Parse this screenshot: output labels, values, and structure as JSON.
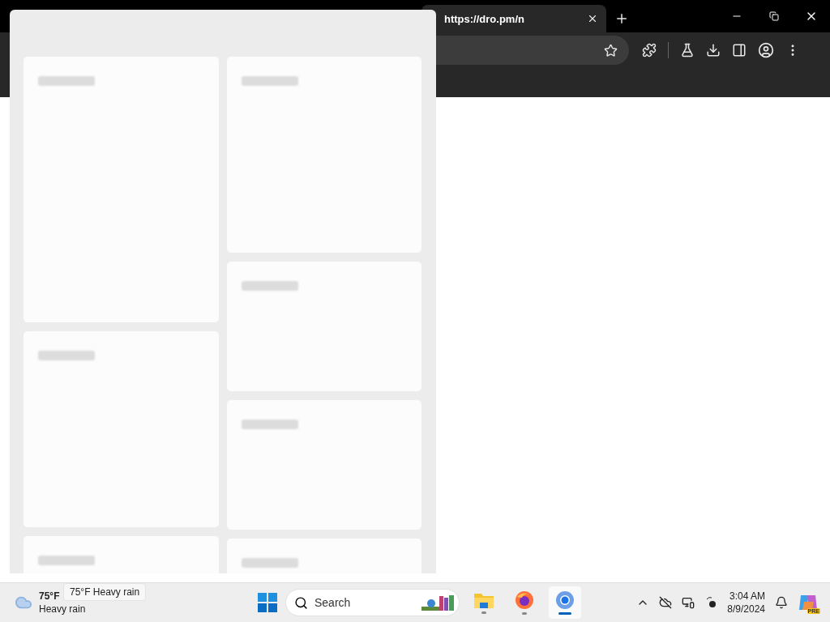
{
  "browser": {
    "tab": {
      "title": "https://dro.pm/n",
      "selected": true
    }
  },
  "taskbar": {
    "weather": {
      "temperature": "75°F",
      "condition": "Heavy rain"
    },
    "tooltip": "75°F Heavy rain",
    "search": {
      "placeholder": "Search"
    },
    "apps": [
      {
        "kind": "explorer",
        "selected": false
      },
      {
        "kind": "firefox",
        "selected": false
      },
      {
        "kind": "chrome",
        "selected": true
      }
    ],
    "clock": {
      "time": "3:04 AM",
      "date": "8/9/2024"
    },
    "copilot_badge": "PRE"
  }
}
